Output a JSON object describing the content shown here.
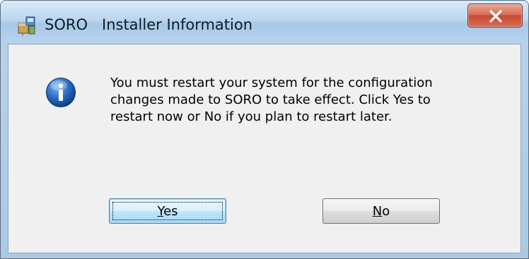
{
  "window": {
    "title": "SORO   Installer Information",
    "app_icon": "installer-package-icon",
    "close_icon": "close-icon"
  },
  "dialog": {
    "icon": "information-icon",
    "message": "You must restart your system for the configuration\nchanges made to SORO   to take effect. Click Yes to\nrestart now or No if you plan to restart later."
  },
  "buttons": {
    "yes": {
      "accel": "Y",
      "rest": "es"
    },
    "no": {
      "accel": "N",
      "rest": "o"
    }
  },
  "colors": {
    "titlebar": "#b6d3ec",
    "close_button": "#c84a33",
    "client_bg": "#f0f0f0",
    "info_icon": "#1f5fb4"
  }
}
